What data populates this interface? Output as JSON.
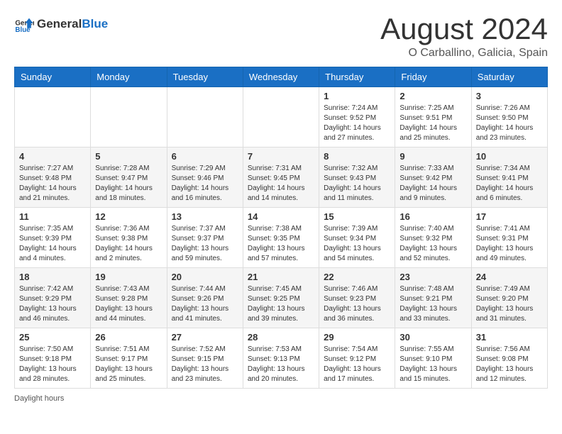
{
  "header": {
    "logo_general": "General",
    "logo_blue": "Blue",
    "month_year": "August 2024",
    "location": "O Carballino, Galicia, Spain"
  },
  "weekdays": [
    "Sunday",
    "Monday",
    "Tuesday",
    "Wednesday",
    "Thursday",
    "Friday",
    "Saturday"
  ],
  "weeks": [
    [
      {
        "day": "",
        "info": ""
      },
      {
        "day": "",
        "info": ""
      },
      {
        "day": "",
        "info": ""
      },
      {
        "day": "",
        "info": ""
      },
      {
        "day": "1",
        "info": "Sunrise: 7:24 AM\nSunset: 9:52 PM\nDaylight: 14 hours and 27 minutes."
      },
      {
        "day": "2",
        "info": "Sunrise: 7:25 AM\nSunset: 9:51 PM\nDaylight: 14 hours and 25 minutes."
      },
      {
        "day": "3",
        "info": "Sunrise: 7:26 AM\nSunset: 9:50 PM\nDaylight: 14 hours and 23 minutes."
      }
    ],
    [
      {
        "day": "4",
        "info": "Sunrise: 7:27 AM\nSunset: 9:48 PM\nDaylight: 14 hours and 21 minutes."
      },
      {
        "day": "5",
        "info": "Sunrise: 7:28 AM\nSunset: 9:47 PM\nDaylight: 14 hours and 18 minutes."
      },
      {
        "day": "6",
        "info": "Sunrise: 7:29 AM\nSunset: 9:46 PM\nDaylight: 14 hours and 16 minutes."
      },
      {
        "day": "7",
        "info": "Sunrise: 7:31 AM\nSunset: 9:45 PM\nDaylight: 14 hours and 14 minutes."
      },
      {
        "day": "8",
        "info": "Sunrise: 7:32 AM\nSunset: 9:43 PM\nDaylight: 14 hours and 11 minutes."
      },
      {
        "day": "9",
        "info": "Sunrise: 7:33 AM\nSunset: 9:42 PM\nDaylight: 14 hours and 9 minutes."
      },
      {
        "day": "10",
        "info": "Sunrise: 7:34 AM\nSunset: 9:41 PM\nDaylight: 14 hours and 6 minutes."
      }
    ],
    [
      {
        "day": "11",
        "info": "Sunrise: 7:35 AM\nSunset: 9:39 PM\nDaylight: 14 hours and 4 minutes."
      },
      {
        "day": "12",
        "info": "Sunrise: 7:36 AM\nSunset: 9:38 PM\nDaylight: 14 hours and 2 minutes."
      },
      {
        "day": "13",
        "info": "Sunrise: 7:37 AM\nSunset: 9:37 PM\nDaylight: 13 hours and 59 minutes."
      },
      {
        "day": "14",
        "info": "Sunrise: 7:38 AM\nSunset: 9:35 PM\nDaylight: 13 hours and 57 minutes."
      },
      {
        "day": "15",
        "info": "Sunrise: 7:39 AM\nSunset: 9:34 PM\nDaylight: 13 hours and 54 minutes."
      },
      {
        "day": "16",
        "info": "Sunrise: 7:40 AM\nSunset: 9:32 PM\nDaylight: 13 hours and 52 minutes."
      },
      {
        "day": "17",
        "info": "Sunrise: 7:41 AM\nSunset: 9:31 PM\nDaylight: 13 hours and 49 minutes."
      }
    ],
    [
      {
        "day": "18",
        "info": "Sunrise: 7:42 AM\nSunset: 9:29 PM\nDaylight: 13 hours and 46 minutes."
      },
      {
        "day": "19",
        "info": "Sunrise: 7:43 AM\nSunset: 9:28 PM\nDaylight: 13 hours and 44 minutes."
      },
      {
        "day": "20",
        "info": "Sunrise: 7:44 AM\nSunset: 9:26 PM\nDaylight: 13 hours and 41 minutes."
      },
      {
        "day": "21",
        "info": "Sunrise: 7:45 AM\nSunset: 9:25 PM\nDaylight: 13 hours and 39 minutes."
      },
      {
        "day": "22",
        "info": "Sunrise: 7:46 AM\nSunset: 9:23 PM\nDaylight: 13 hours and 36 minutes."
      },
      {
        "day": "23",
        "info": "Sunrise: 7:48 AM\nSunset: 9:21 PM\nDaylight: 13 hours and 33 minutes."
      },
      {
        "day": "24",
        "info": "Sunrise: 7:49 AM\nSunset: 9:20 PM\nDaylight: 13 hours and 31 minutes."
      }
    ],
    [
      {
        "day": "25",
        "info": "Sunrise: 7:50 AM\nSunset: 9:18 PM\nDaylight: 13 hours and 28 minutes."
      },
      {
        "day": "26",
        "info": "Sunrise: 7:51 AM\nSunset: 9:17 PM\nDaylight: 13 hours and 25 minutes."
      },
      {
        "day": "27",
        "info": "Sunrise: 7:52 AM\nSunset: 9:15 PM\nDaylight: 13 hours and 23 minutes."
      },
      {
        "day": "28",
        "info": "Sunrise: 7:53 AM\nSunset: 9:13 PM\nDaylight: 13 hours and 20 minutes."
      },
      {
        "day": "29",
        "info": "Sunrise: 7:54 AM\nSunset: 9:12 PM\nDaylight: 13 hours and 17 minutes."
      },
      {
        "day": "30",
        "info": "Sunrise: 7:55 AM\nSunset: 9:10 PM\nDaylight: 13 hours and 15 minutes."
      },
      {
        "day": "31",
        "info": "Sunrise: 7:56 AM\nSunset: 9:08 PM\nDaylight: 13 hours and 12 minutes."
      }
    ]
  ],
  "footer": {
    "daylight_label": "Daylight hours"
  }
}
